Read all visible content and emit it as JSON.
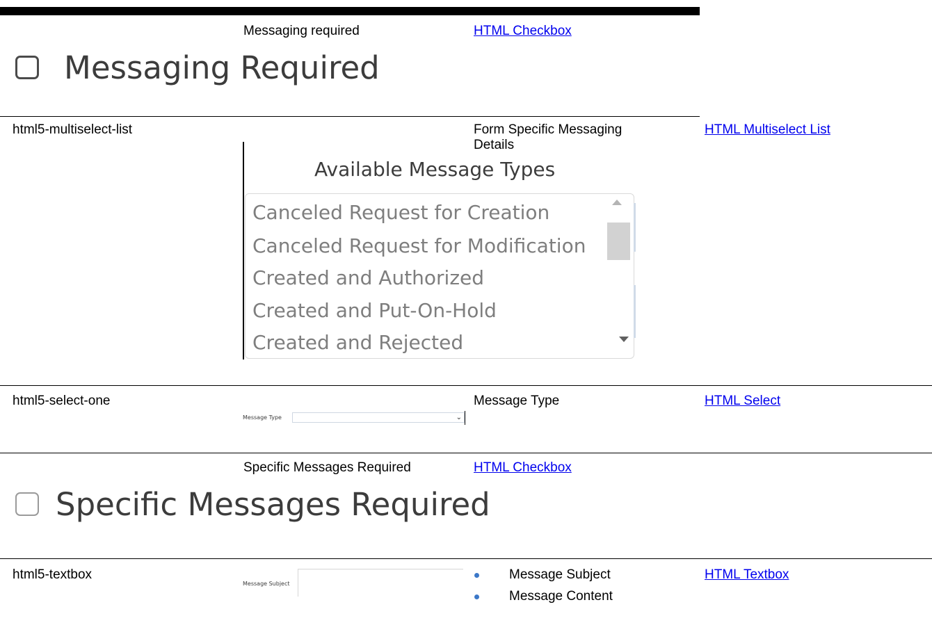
{
  "rows": [
    {
      "name": "Messaging required",
      "link": "HTML Checkbox",
      "image": {
        "checkbox_label": "Messaging Required",
        "checked": false
      }
    },
    {
      "id": "html5-multiselect-list",
      "name": "Form Specific Messaging Details",
      "link": "HTML Multiselect List",
      "image": {
        "heading": "Available Message Types",
        "options": [
          "Canceled Request for Creation",
          "Canceled Request for Modification",
          "Created and Authorized",
          "Created and Put-On-Hold",
          "Created and Rejected"
        ]
      }
    },
    {
      "id": "html5-select-one",
      "name": "Message Type",
      "link": "HTML Select",
      "image": {
        "label": "Message Type",
        "value": ""
      }
    },
    {
      "name": "Specific Messages Required",
      "link": "HTML Checkbox",
      "image": {
        "checkbox_label": "Specific Messages Required",
        "checked": false
      }
    },
    {
      "id": "html5-textbox",
      "names": [
        "Message Subject",
        "Message Content"
      ],
      "link": "HTML Textbox",
      "image": {
        "label": "Message Subject",
        "value": ""
      }
    }
  ],
  "icons": {
    "scroll_up": "triangle-up-icon",
    "scroll_down": "triangle-down-icon",
    "dropdown": "chevron-down-icon",
    "bullet": "bullet-dot-icon"
  },
  "colors": {
    "link": "#0000ee",
    "bullet": "#3c78c8",
    "list_text": "#7e7e7e"
  }
}
